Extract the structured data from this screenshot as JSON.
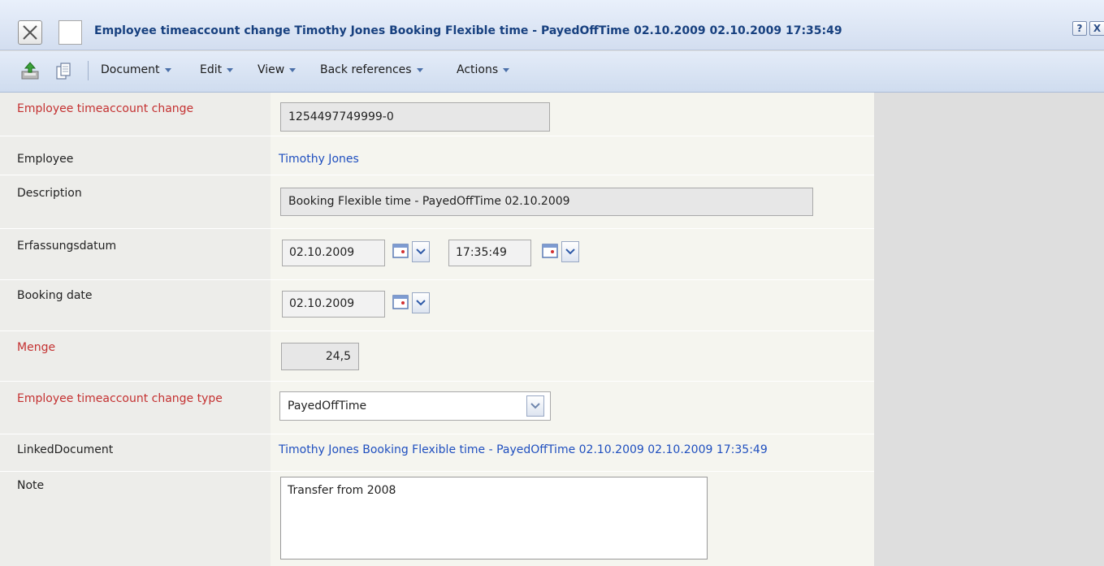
{
  "window": {
    "title": "Employee timeaccount change Timothy Jones Booking Flexible time - PayedOffTime 02.10.2009 02.10.2009 17:35:49",
    "help_label": "?",
    "close_label": "X"
  },
  "toolbar": {
    "icons": [
      "save-icon",
      "copy-icon"
    ],
    "menus": [
      {
        "label": "Document"
      },
      {
        "label": "Edit"
      },
      {
        "label": "View"
      },
      {
        "label": "Back references"
      },
      {
        "label": "Actions"
      }
    ]
  },
  "form": {
    "id": {
      "label": "Employee timeaccount change",
      "value": "1254497749999-0",
      "required": true
    },
    "employee": {
      "label": "Employee",
      "value": "Timothy Jones"
    },
    "description": {
      "label": "Description",
      "value": "Booking Flexible time - PayedOffTime 02.10.2009"
    },
    "erfassungsdatum": {
      "label": "Erfassungsdatum",
      "date": "02.10.2009",
      "time": "17:35:49"
    },
    "booking_date": {
      "label": "Booking date",
      "date": "02.10.2009"
    },
    "menge": {
      "label": "Menge",
      "value": "24,5",
      "required": true
    },
    "change_type": {
      "label": "Employee timeaccount change type",
      "value": "PayedOffTime",
      "required": true
    },
    "linked_document": {
      "label": "LinkedDocument",
      "value": "Timothy Jones Booking Flexible time - PayedOffTime 02.10.2009 02.10.2009 17:35:49"
    },
    "note": {
      "label": "Note",
      "value": "Transfer from 2008"
    }
  },
  "colors": {
    "title_text": "#17407f",
    "required_label": "#c43131",
    "link": "#1f4fbf"
  }
}
